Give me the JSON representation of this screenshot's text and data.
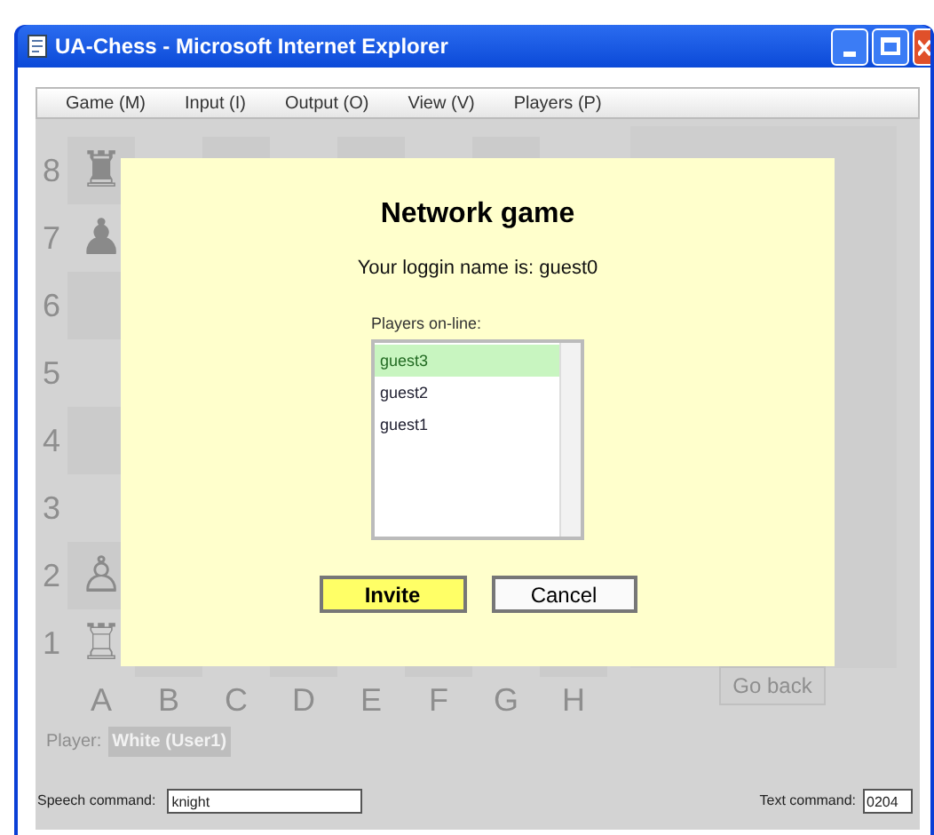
{
  "window": {
    "title": "UA-Chess - Microsoft Internet Explorer"
  },
  "menu": [
    "Game (M)",
    "Input (I)",
    "Output (O)",
    "View (V)",
    "Players (P)"
  ],
  "board": {
    "files": [
      "A",
      "B",
      "C",
      "D",
      "E",
      "F",
      "G",
      "H"
    ],
    "rows": [
      {
        "rank": "8",
        "pieces": [
          "♜"
        ]
      },
      {
        "rank": "7",
        "pieces": [
          "♟"
        ]
      },
      {
        "rank": "6"
      },
      {
        "rank": "5"
      },
      {
        "rank": "4"
      },
      {
        "rank": "3"
      },
      {
        "rank": "2",
        "pieces": [
          "♙"
        ]
      },
      {
        "rank": "1",
        "pieces": [
          "♖"
        ]
      }
    ]
  },
  "go_back_button": "Go back",
  "player": {
    "label": "Player:",
    "value": "White (User1)"
  },
  "dialog": {
    "title": "Network game",
    "login": "Your loggin name is: guest0",
    "list_label": "Players on-line:",
    "players": [
      {
        "name": "guest3",
        "selected": true
      },
      {
        "name": "guest2",
        "selected": false
      },
      {
        "name": "guest1",
        "selected": false
      }
    ],
    "invite": "Invite",
    "cancel": "Cancel"
  },
  "speech": {
    "label": "Speech command:",
    "value": "knight"
  },
  "text_command": {
    "label": "Text command:",
    "value": "0204"
  }
}
